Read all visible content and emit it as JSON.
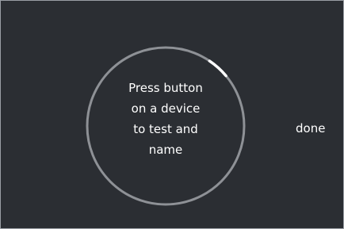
{
  "prompt": {
    "lines": [
      "Press button",
      "on a device",
      "to test and",
      "name"
    ]
  },
  "done_label": "done",
  "progress": {
    "fraction": 0.045
  },
  "colors": {
    "background": "#2b2e33",
    "ring": "#8e9196",
    "progress_arc": "#ffffff",
    "text": "#ffffff",
    "frame_border": "#9a9ea4"
  }
}
